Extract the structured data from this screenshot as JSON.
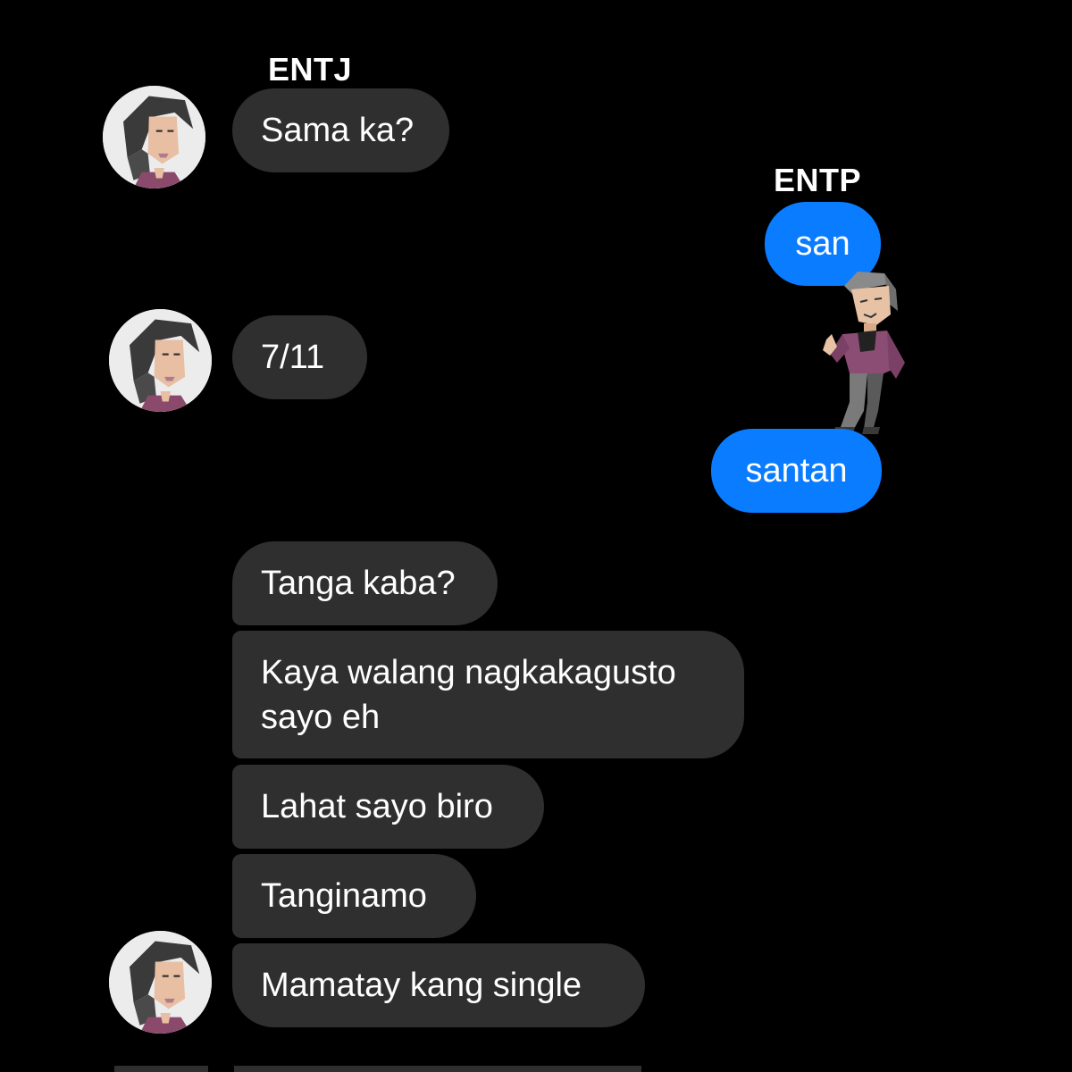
{
  "labels": {
    "left": "ENTJ",
    "right": "ENTP"
  },
  "messages": {
    "m1": "Sama ka?",
    "m2": "san",
    "m3": "7/11",
    "m4": "santan",
    "m5": "Tanga kaba?",
    "m6": "Kaya walang nagkakagusto sayo eh",
    "m7": "Lahat sayo biro",
    "m8": "Tanginamo",
    "m9": "Mamatay kang single"
  },
  "colors": {
    "background": "#000000",
    "incoming_bubble": "#2f2f2f",
    "outgoing_bubble": "#0a7cff",
    "text": "#ffffff"
  },
  "icons": {
    "avatar": "entj-avatar-icon",
    "sticker": "entp-character-sticker"
  }
}
